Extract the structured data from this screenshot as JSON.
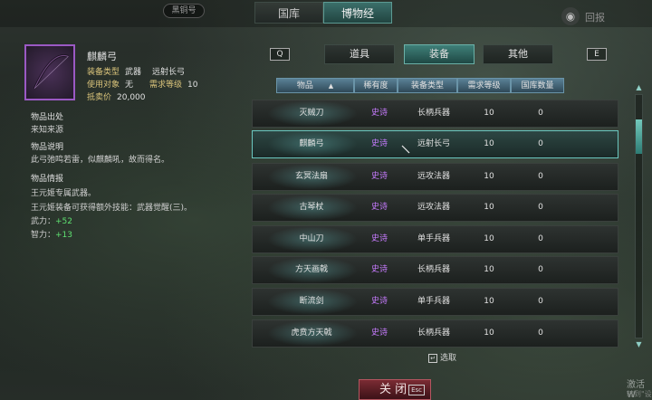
{
  "top": {
    "badge": "黑铜号",
    "main_tabs": [
      "国库",
      "博物经"
    ],
    "right_text": "回报"
  },
  "item": {
    "name": "麒麟弓",
    "type_label": "装备类型",
    "type_value": "武器",
    "subtype_value": "远射长弓",
    "target_label": "使用对象",
    "target_value": "无",
    "req_label": "需求等级",
    "req_value": "10",
    "price_label": "抵卖价",
    "price_value": "20,000",
    "origin_title": "物品出处",
    "origin_text": "来知来源",
    "desc_title": "物品说明",
    "desc_text": "此弓弛鸣若雷，似麒麟吼，故而得名。",
    "info_title": "物品情报",
    "info_line1": "王元姬专属武器。",
    "info_line2": "王元姬装备可获得额外技能：武器觉醒(三)。",
    "stat1_label": "武力：",
    "stat1_value": "+52",
    "stat2_label": "智力：",
    "stat2_value": "+13"
  },
  "nav": {
    "left_key": "Q",
    "right_key": "E",
    "tabs": [
      "道具",
      "装备",
      "其他"
    ]
  },
  "table": {
    "headers": [
      "物品",
      "稀有度",
      "装备类型",
      "需求等级",
      "国库数量"
    ],
    "sort_indicator": "▲",
    "rows": [
      {
        "name": "灭贼刀",
        "rarity": "史诗",
        "type": "长柄兵器",
        "req": "10",
        "stock": "0"
      },
      {
        "name": "麒麟弓",
        "rarity": "史诗",
        "type": "远射长弓",
        "req": "10",
        "stock": "0"
      },
      {
        "name": "玄冥法扇",
        "rarity": "史诗",
        "type": "远攻法器",
        "req": "10",
        "stock": "0"
      },
      {
        "name": "古琴杖",
        "rarity": "史诗",
        "type": "远攻法器",
        "req": "10",
        "stock": "0"
      },
      {
        "name": "中山刀",
        "rarity": "史诗",
        "type": "单手兵器",
        "req": "10",
        "stock": "0"
      },
      {
        "name": "方天画戟",
        "rarity": "史诗",
        "type": "长柄兵器",
        "req": "10",
        "stock": "0"
      },
      {
        "name": "断流剑",
        "rarity": "史诗",
        "type": "单手兵器",
        "req": "10",
        "stock": "0"
      },
      {
        "name": "虎贲方天戟",
        "rarity": "史诗",
        "type": "长柄兵器",
        "req": "10",
        "stock": "0"
      }
    ]
  },
  "bottom": {
    "select_hint": "选取",
    "close_label": "关 闭",
    "esc_label": "Esc",
    "watermark1": "激活 W",
    "watermark2": "转到\"设"
  },
  "colors": {
    "epic": "#c77bff",
    "bonus": "#5ee070",
    "accent": "#3f8079"
  }
}
